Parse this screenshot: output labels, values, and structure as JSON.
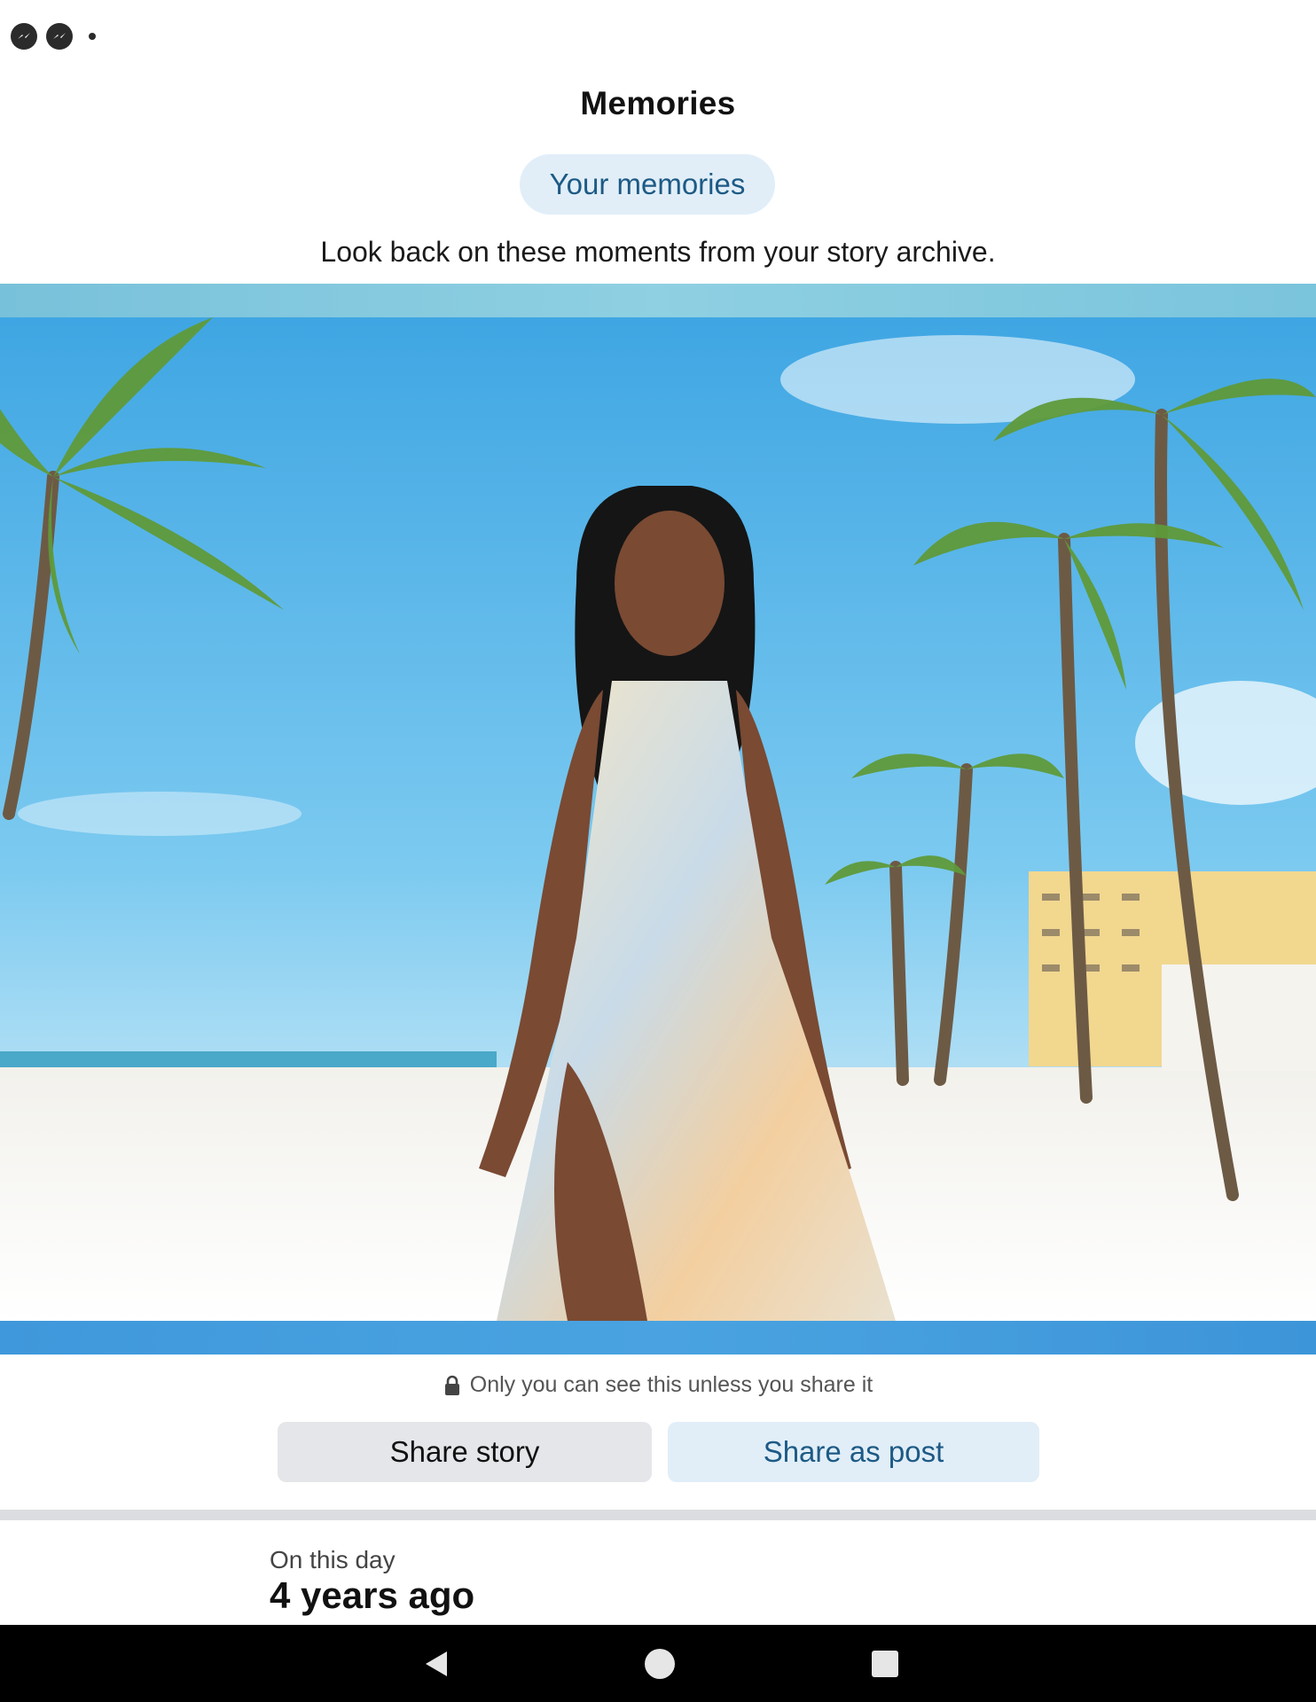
{
  "header": {
    "title": "Memories",
    "chip_label": "Your memories",
    "subtitle": "Look back on these moments from your story archive."
  },
  "photo": {
    "description_icon": "memory-photo"
  },
  "privacy": {
    "note": "Only you can see this unless you share it",
    "icon": "lock-icon"
  },
  "actions": {
    "share_story": "Share story",
    "share_post": "Share as post"
  },
  "memory_info": {
    "label": "On this day",
    "age": "4 years ago"
  },
  "status_icons": [
    "messenger-icon",
    "messenger-icon"
  ],
  "nav": {
    "back": "back-icon",
    "home": "home-icon",
    "recents": "recents-icon"
  },
  "colors": {
    "accent": "#1d5a85",
    "chip_bg": "#e1eef8",
    "button_gray": "#e4e6e9"
  }
}
